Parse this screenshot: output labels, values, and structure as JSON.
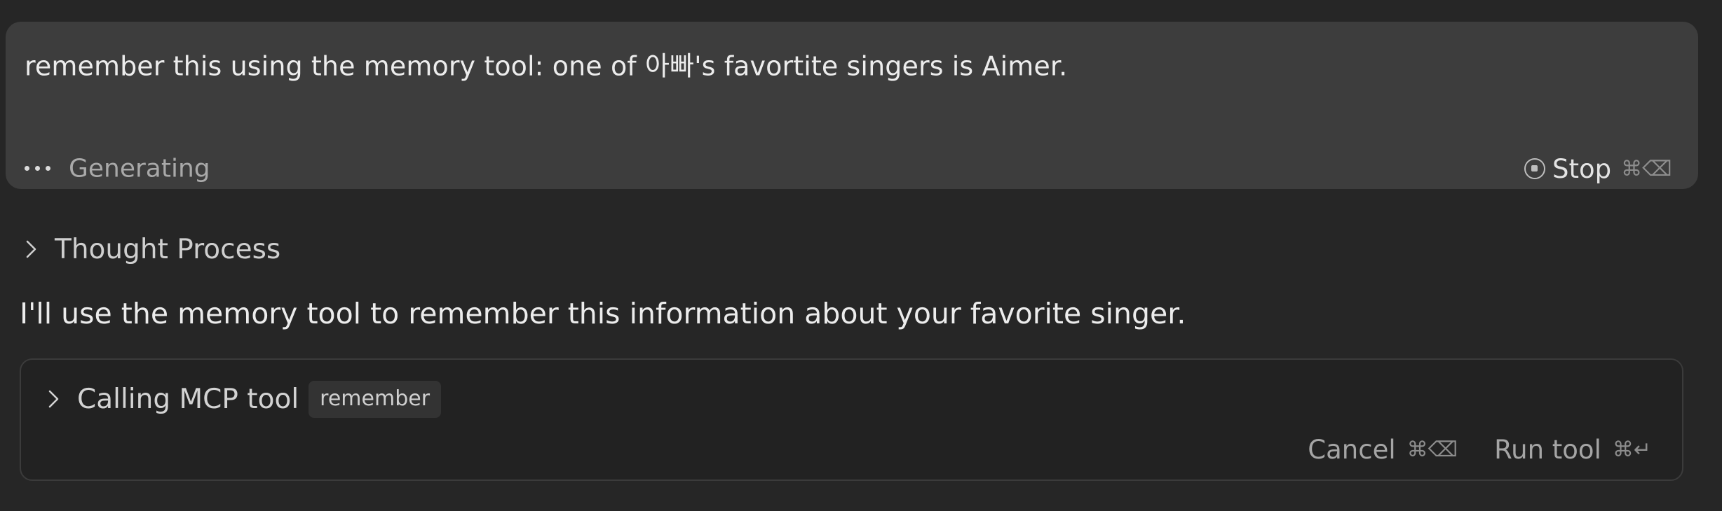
{
  "prompt": {
    "text": "remember this using the memory tool: one of 아빠's favortite singers is Aimer.",
    "status_label": "Generating",
    "stop_label": "Stop",
    "stop_shortcut": "⌘⌫"
  },
  "thought": {
    "label": "Thought Process"
  },
  "response": {
    "text": "I'll use the memory tool to remember this information about your favorite singer."
  },
  "tool_call": {
    "title": "Calling MCP tool",
    "tool_name": "remember",
    "cancel_label": "Cancel",
    "cancel_shortcut": "⌘⌫",
    "run_label": "Run tool",
    "run_shortcut": "⌘↵"
  },
  "icons": {
    "status": "ellipsis-icon",
    "stop": "stop-circle-icon",
    "expand": "chevron-right-icon"
  },
  "colors": {
    "background": "#262626",
    "prompt_card": "#3d3d3d",
    "tool_card_border": "#3b3b3b",
    "tool_badge": "#333333"
  }
}
